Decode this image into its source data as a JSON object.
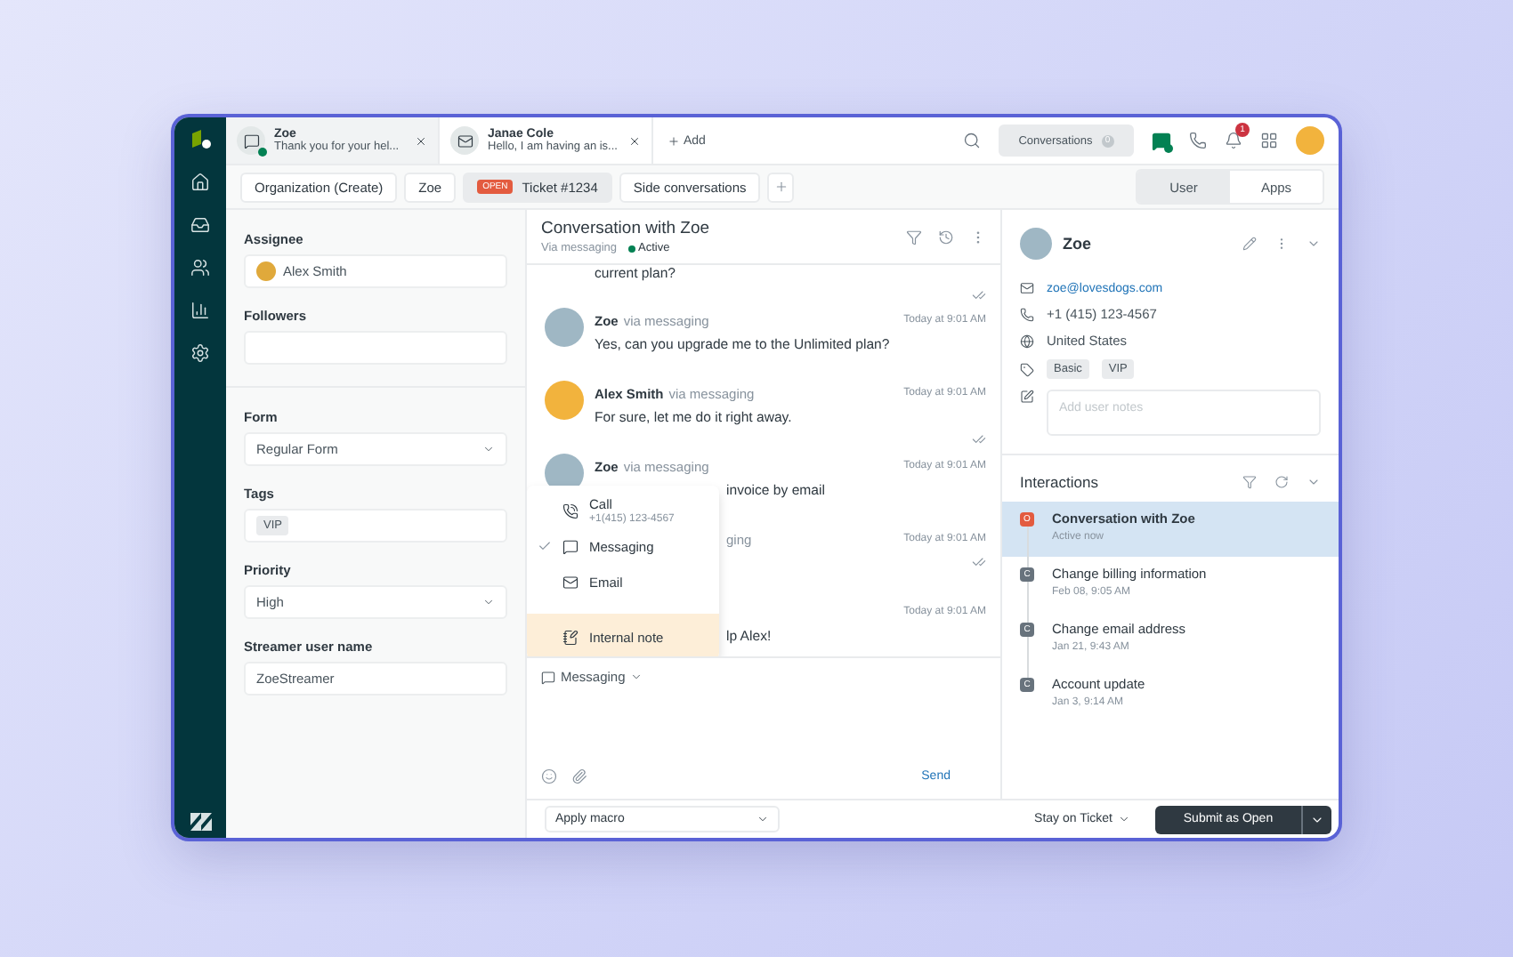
{
  "top_tabs": [
    {
      "kind": "messaging",
      "title": "Zoe",
      "preview": "Thank you for your hel...",
      "online": true,
      "selected": true
    },
    {
      "kind": "email",
      "title": "Janae Cole",
      "preview": "Hello, I am having an is...",
      "online": false,
      "selected": false
    }
  ],
  "add_tab": "Add",
  "conversations_button": {
    "label": "Conversations",
    "count": "0"
  },
  "notifications_badge": "1",
  "breadcrumbs": [
    {
      "label": "Organization (Create)",
      "selected": false
    },
    {
      "label": "Zoe",
      "selected": false
    },
    {
      "label": "Ticket #1234",
      "status": "OPEN",
      "selected": true
    },
    {
      "label": "Side conversations",
      "selected": false
    }
  ],
  "context_tabs": [
    {
      "label": "User",
      "selected": true
    },
    {
      "label": "Apps",
      "selected": false
    }
  ],
  "ticket_fields": {
    "people": [
      {
        "kind": "person",
        "label": "Assignee",
        "value": "Alex Smith"
      },
      {
        "kind": "text",
        "label": "Followers"
      }
    ],
    "properties": [
      {
        "kind": "select",
        "label": "Form",
        "value": "Regular Form"
      },
      {
        "kind": "tags",
        "label": "Tags",
        "tags": [
          "VIP"
        ]
      },
      {
        "kind": "select",
        "label": "Priority",
        "value": "High"
      },
      {
        "kind": "text",
        "label": "Streamer user name",
        "value": "ZoeStreamer"
      }
    ]
  },
  "conversation": {
    "title": "Conversation with Zoe",
    "channel": "Via messaging",
    "status": "Active",
    "messages": [
      {
        "kind": "tail",
        "text": "current plan?",
        "read": true
      },
      {
        "kind": "full",
        "author": "Zoe",
        "via": "via messaging",
        "time": "Today at 9:01 AM",
        "text": "Yes, can you upgrade me to the Unlimited plan?",
        "read": false
      },
      {
        "kind": "full",
        "author": "Alex Smith",
        "agent": true,
        "via": "via messaging",
        "time": "Today at 9:01 AM",
        "text": "For sure, let me do it right away.",
        "read": true
      },
      {
        "kind": "covered",
        "author": "Zoe",
        "via": "via messaging",
        "time": "Today at 9:01 AM",
        "text": "invoice by email",
        "read": false
      },
      {
        "kind": "covered",
        "via": "ging",
        "time": "Today at 9:01 AM",
        "read": true
      },
      {
        "kind": "covered",
        "time": "Today at 9:01 AM",
        "text": "lp Alex!",
        "read": false
      }
    ],
    "channel_menu": [
      {
        "kind": "call",
        "label": "Call",
        "detail": "+1(415) 123-4567",
        "checked": false,
        "highlighted": false
      },
      {
        "kind": "messaging",
        "label": "Messaging",
        "checked": true,
        "highlighted": false
      },
      {
        "kind": "email",
        "label": "Email",
        "checked": false,
        "highlighted": false
      },
      {
        "kind": "note",
        "label": "Internal note",
        "checked": false,
        "highlighted": true
      }
    ],
    "composer": {
      "channel": "Messaging",
      "send": "Send"
    }
  },
  "user": {
    "name": "Zoe",
    "email": "zoe@lovesdogs.com",
    "phone": "+1 (415) 123-4567",
    "country": "United States",
    "tags": [
      "Basic",
      "VIP"
    ],
    "notes_placeholder": "Add user notes"
  },
  "interactions": {
    "title": "Interactions",
    "items": [
      {
        "kind": "open",
        "badge": "O",
        "title": "Conversation with Zoe",
        "time": "Active now",
        "selected": true
      },
      {
        "kind": "closed",
        "badge": "C",
        "title": "Change billing information",
        "time": "Feb 08, 9:05 AM",
        "selected": false
      },
      {
        "kind": "closed",
        "badge": "C",
        "title": "Change email address",
        "time": "Jan 21, 9:43 AM",
        "selected": false
      },
      {
        "kind": "closed",
        "badge": "C",
        "title": "Account update",
        "time": "Jan 3, 9:14 AM",
        "selected": false
      }
    ]
  },
  "footer": {
    "macro": "Apply macro",
    "stay": "Stay on Ticket",
    "submit": "Submit as Open"
  }
}
